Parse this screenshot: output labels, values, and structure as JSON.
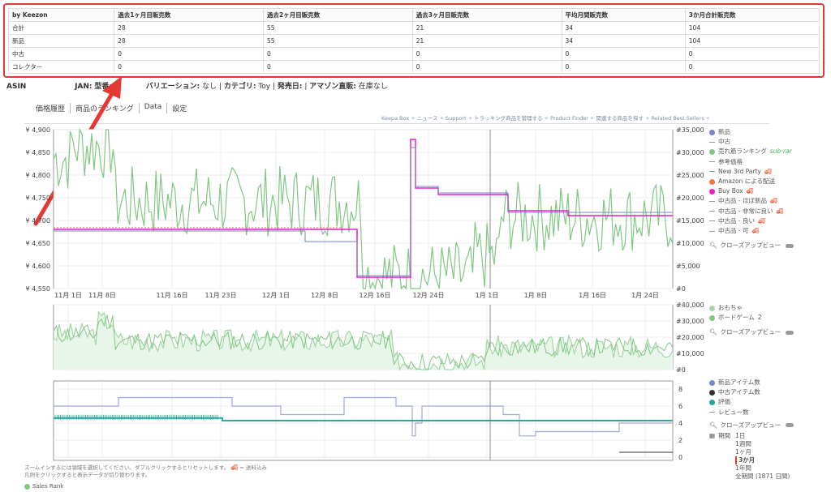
{
  "sales_table": {
    "headers": [
      "by Keezon",
      "過去1ヶ月目販売数",
      "過去2ヶ月目販売数",
      "過去3ヶ月目販売数",
      "平均月間販売数",
      "3か月合計販売数"
    ],
    "rows": [
      [
        "合計",
        "28",
        "55",
        "21",
        "34",
        "104"
      ],
      [
        "新品",
        "28",
        "55",
        "21",
        "34",
        "104"
      ],
      [
        "中古",
        "0",
        "0",
        "0",
        "0",
        "0"
      ],
      [
        "コレクター",
        "0",
        "0",
        "0",
        "0",
        "0"
      ]
    ]
  },
  "info": {
    "asin_label": "ASIN",
    "jan_label": "JAN:",
    "model_label": "型番:",
    "variation_label": "バリエーション:",
    "variation_value": "なし",
    "category_label": "カテゴリ:",
    "category_value": "Toy",
    "release_label": "発売日:",
    "amazon_label": "アマゾン直販:",
    "amazon_value": "在庫なし"
  },
  "tabs": [
    "価格履歴",
    "商品のランキング",
    "Data",
    "設定"
  ],
  "links_bar": "Keepa Box ✧ ニュース ✧ Support ✧ トラッキング商品を管理する ✧ Product Finder ✧ 関連する商品を探す ✧ Related Best Sellers ✧",
  "chart_main": {
    "type": "line",
    "y_left_ticks": [
      "¥ 4,900",
      "¥ 4,850",
      "¥ 4,800",
      "¥ 4,750",
      "¥ 4,700",
      "¥ 4,650",
      "¥ 4,600",
      "¥ 4,550"
    ],
    "y_right_ticks": [
      "#35,000",
      "#30,000",
      "#25,000",
      "#20,000",
      "#15,000",
      "#10,000",
      "#5,000",
      "#0"
    ],
    "x_ticks": [
      "11月 1日",
      "11月 8日",
      "11月 16日",
      "11月 23日",
      "12月 1日",
      "12月 8日",
      "12月 16日",
      "12月 24日",
      "1月 1日",
      "1月 8日",
      "1月 16日",
      "1月 24日"
    ]
  },
  "chart_rank": {
    "y_right_ticks": [
      "#40,000",
      "#30,000",
      "#20,000",
      "#10,000",
      "#0"
    ]
  },
  "chart_count": {
    "y_right_ticks": [
      "8",
      "6",
      "4",
      "2",
      "0"
    ]
  },
  "legend_main": {
    "items": [
      {
        "label": "新品",
        "kind": "dot",
        "color": "#7986cb"
      },
      {
        "label": "中古",
        "kind": "dash",
        "color": "#999999"
      },
      {
        "label": "売れ筋ランキング",
        "kind": "dot",
        "color": "#81c784",
        "extra": "sub-rar"
      },
      {
        "label": "参考価格",
        "kind": "dash",
        "color": "#999999"
      },
      {
        "label": "New 3rd Party",
        "kind": "dash",
        "color": "#999999",
        "truck": true
      },
      {
        "label": "Amazon による配送",
        "kind": "dot",
        "color": "#ff7043"
      },
      {
        "label": "Buy Box",
        "kind": "dot",
        "color": "#e91ec8",
        "truck": true
      },
      {
        "label": "中古品 - ほぼ新品",
        "kind": "dash",
        "color": "#999999",
        "truck": true
      },
      {
        "label": "中古品 - 非常に良い",
        "kind": "dash",
        "color": "#999999",
        "truck": true
      },
      {
        "label": "中古品 - 良い",
        "kind": "dash",
        "color": "#999999",
        "truck": true
      },
      {
        "label": "中古品 - 可",
        "kind": "dash",
        "color": "#999999",
        "truck": true
      }
    ],
    "closeup": "クローズアップビュー"
  },
  "legend_rank": {
    "items": [
      {
        "label": "おもちゃ",
        "color": "#a5d6a7"
      },
      {
        "label": "ボードゲーム",
        "color": "#81c784",
        "extra": "2"
      }
    ],
    "closeup": "クローズアップビュー"
  },
  "legend_count": {
    "items": [
      {
        "label": "新品アイテム数",
        "kind": "dot",
        "color": "#7986cb"
      },
      {
        "label": "中古アイテム数",
        "kind": "dot",
        "color": "#333333"
      },
      {
        "label": "評価",
        "kind": "dot",
        "color": "#26a69a"
      },
      {
        "label": "レビュー数",
        "kind": "dash",
        "color": "#999999"
      }
    ],
    "closeup": "クローズアップビュー",
    "period_label": "期間",
    "periods": [
      "1日",
      "1週間",
      "1ヶ月",
      "3か月",
      "1年間",
      "全期間 (1871 日間)"
    ],
    "active_period": "3か月"
  },
  "foot_note": {
    "line1": "ズームインするには領域を選択してください。ダブルクリックするとリセットします。",
    "line1_suffix": "= 送料込み",
    "line2": "凡例をクリックすると表示データが切り替わります。"
  },
  "sales_rank_label": "Sales Rank",
  "colors": {
    "highlight_red": "#e53935",
    "sales_rank_green": "#81c784",
    "buy_box_magenta": "#e91ec8",
    "new_purple": "#7986cb",
    "rating_teal": "#26a69a"
  }
}
